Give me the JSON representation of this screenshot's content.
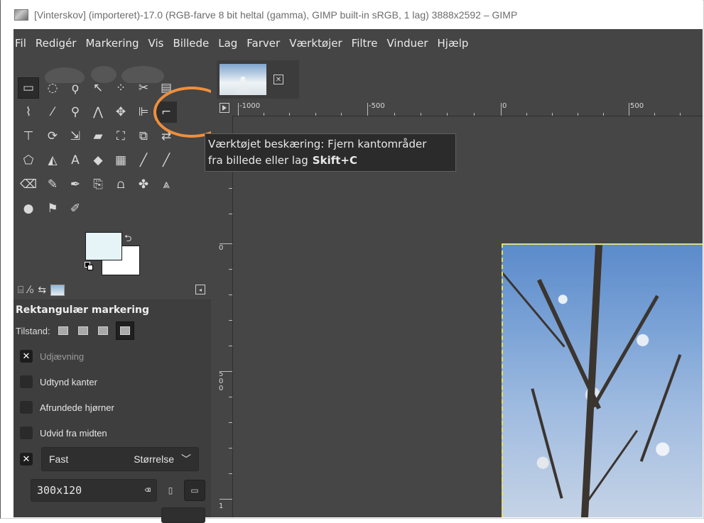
{
  "window": {
    "title": "[Vinterskov] (importeret)-17.0 (RGB-farve 8 bit heltal (gamma), GIMP built-in sRGB, 1 lag) 3888x2592 – GIMP"
  },
  "menu": {
    "items": [
      "Fil",
      "Redigér",
      "Markering",
      "Vis",
      "Billede",
      "Lag",
      "Farver",
      "Værktøjer",
      "Filtre",
      "Vinduer",
      "Hjælp"
    ]
  },
  "colors": {
    "foreground": "#e6f4f8",
    "background": "#ffffff",
    "highlight": "#ef8f3c",
    "selection_dash": "#e7e05a"
  },
  "tool_options": {
    "title": "Rektangulær markering",
    "mode_label": "Tilstand:",
    "antialias_label": "Udjævning",
    "feather_label": "Udtynd kanter",
    "rounded_label": "Afrundede hjørner",
    "expand_label": "Udvid fra midten",
    "fixed_label": "Fast",
    "fixed_select": "Størrelse",
    "size_value": "300x120"
  },
  "tooltip": {
    "line1": "Værktøjet beskæring: Fjern kantområder",
    "line2": "fra billede eller lag",
    "shortcut": "Skift+C"
  },
  "rulers": {
    "h_labels": [
      "-1000",
      "-500",
      "0",
      "500"
    ],
    "v_labels": [
      "0",
      "500",
      "1"
    ]
  }
}
